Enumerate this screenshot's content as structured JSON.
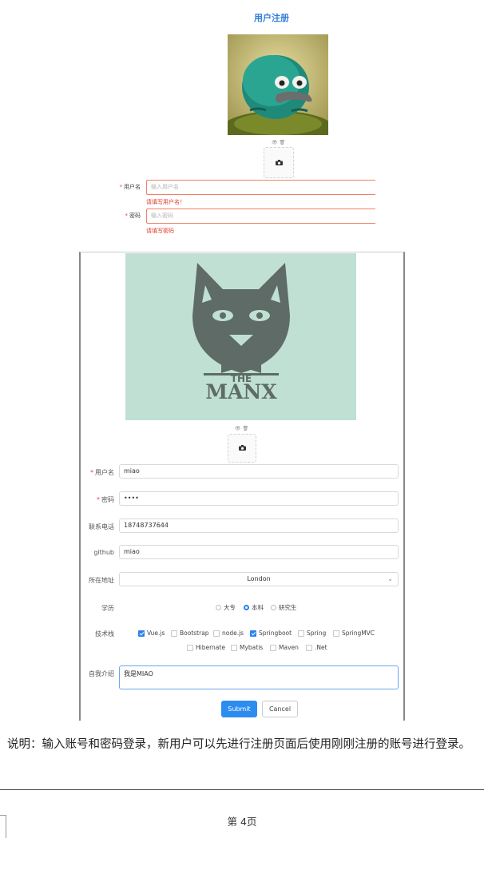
{
  "register_form": {
    "title": "用户注册",
    "upload_tools": "👁 🗑",
    "username_label": "用户名",
    "username_placeholder": "输入用户名",
    "username_error": "请填写用户名！",
    "password_label": "密码",
    "password_placeholder": "输入密码",
    "password_error": "请填写密码"
  },
  "filled_form": {
    "upload_tools": "👁 🗑",
    "logo_text": "MANX",
    "logo_small": "THE",
    "fields": {
      "username": {
        "label": "用户名",
        "value": "miao"
      },
      "password": {
        "label": "密码",
        "value": "••••"
      },
      "phone": {
        "label": "联系电话",
        "value": "18748737644"
      },
      "github": {
        "label": "github",
        "value": "miao"
      },
      "location": {
        "label": "所在地址",
        "value": "London"
      }
    },
    "education": {
      "label": "学历",
      "options": [
        "大专",
        "本科",
        "研究生"
      ],
      "selected": "本科"
    },
    "tech": {
      "label": "技术栈",
      "row1": [
        {
          "name": "Vue.js",
          "checked": true
        },
        {
          "name": "Bootstrap",
          "checked": false
        },
        {
          "name": "node.js",
          "checked": false
        },
        {
          "name": "Springboot",
          "checked": true
        },
        {
          "name": "Spring",
          "checked": false
        },
        {
          "name": "SpringMVC",
          "checked": false
        }
      ],
      "row2": [
        {
          "name": "Hibernate",
          "checked": false
        },
        {
          "name": "Mybatis",
          "checked": false
        },
        {
          "name": "Maven",
          "checked": false
        },
        {
          "name": ".Net",
          "checked": false
        }
      ]
    },
    "intro": {
      "label": "自我介绍",
      "value": "我是MIAO"
    },
    "submit_label": "Submit",
    "cancel_label": "Cancel"
  },
  "description": "说明：输入账号和密码登录，新用户可以先进行注册页面后使用刚刚注册的账号进行登录。",
  "page_number": "第 4页",
  "colors": {
    "accent": "#2d8cf0",
    "error": "#e0392b",
    "title": "#2f7ed8"
  }
}
